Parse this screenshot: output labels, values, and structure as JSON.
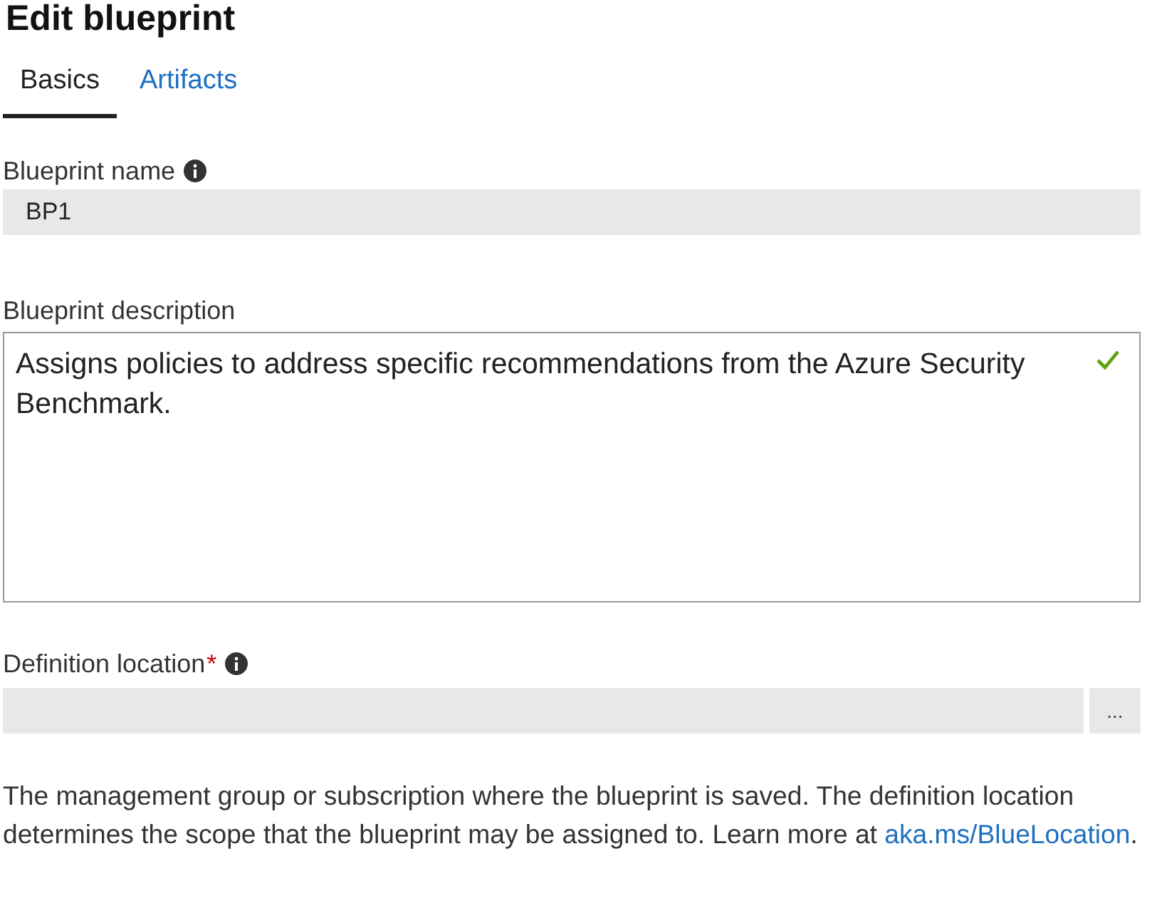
{
  "title": "Edit blueprint",
  "tabs": [
    {
      "label": "Basics",
      "selected": true
    },
    {
      "label": "Artifacts",
      "selected": false
    }
  ],
  "name_field": {
    "label": "Blueprint name",
    "info": true,
    "value": "BP1",
    "disabled": true
  },
  "description_field": {
    "label": "Blueprint description",
    "value": "Assigns policies to address specific recommendations from the Azure Security Benchmark.",
    "valid": true
  },
  "location_field": {
    "label": "Definition location",
    "required": true,
    "required_mark": "*",
    "info": true,
    "disabled": true,
    "button": "..."
  },
  "help": {
    "text": "The management group or subscription where the blueprint is saved. The definition location determines the scope that the blueprint may be assigned to. Learn more at ",
    "link": "aka.ms/BlueLocation",
    "tail": "."
  }
}
